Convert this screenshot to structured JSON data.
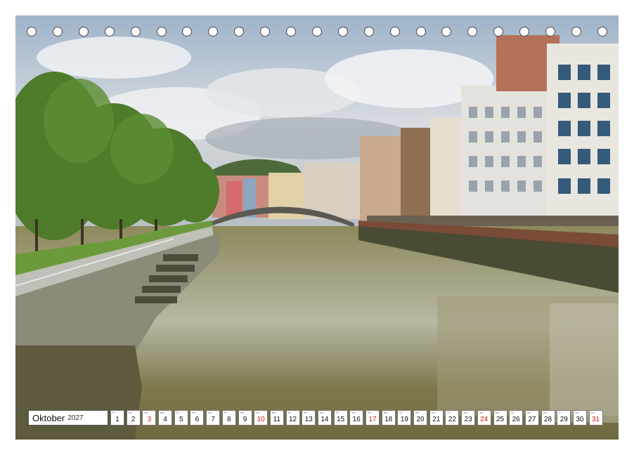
{
  "photo": {
    "subject": "river-city-scene-icon",
    "colors": {
      "sky": "#c9d2dc",
      "water": "#8b8457",
      "trees": "#4f7d2a",
      "buildings": "#d9d3c4"
    }
  },
  "calendar": {
    "month": "Oktober",
    "year": "2027",
    "sunday_color": "#d11a1a",
    "days": [
      {
        "d": "1",
        "wd": "Fr",
        "sun": false
      },
      {
        "d": "2",
        "wd": "Sa",
        "sun": false
      },
      {
        "d": "3",
        "wd": "So",
        "sun": true
      },
      {
        "d": "4",
        "wd": "Mo",
        "sun": false
      },
      {
        "d": "5",
        "wd": "Di",
        "sun": false
      },
      {
        "d": "6",
        "wd": "Mi",
        "sun": false
      },
      {
        "d": "7",
        "wd": "Do",
        "sun": false
      },
      {
        "d": "8",
        "wd": "Fr",
        "sun": false
      },
      {
        "d": "9",
        "wd": "Sa",
        "sun": false
      },
      {
        "d": "10",
        "wd": "So",
        "sun": true
      },
      {
        "d": "11",
        "wd": "Mo",
        "sun": false
      },
      {
        "d": "12",
        "wd": "Di",
        "sun": false
      },
      {
        "d": "13",
        "wd": "Mi",
        "sun": false
      },
      {
        "d": "14",
        "wd": "Do",
        "sun": false
      },
      {
        "d": "15",
        "wd": "Fr",
        "sun": false
      },
      {
        "d": "16",
        "wd": "Sa",
        "sun": false
      },
      {
        "d": "17",
        "wd": "So",
        "sun": true
      },
      {
        "d": "18",
        "wd": "Mo",
        "sun": false
      },
      {
        "d": "19",
        "wd": "Di",
        "sun": false
      },
      {
        "d": "20",
        "wd": "Mi",
        "sun": false
      },
      {
        "d": "21",
        "wd": "Do",
        "sun": false
      },
      {
        "d": "22",
        "wd": "Fr",
        "sun": false
      },
      {
        "d": "23",
        "wd": "Sa",
        "sun": false
      },
      {
        "d": "24",
        "wd": "So",
        "sun": true
      },
      {
        "d": "25",
        "wd": "Mo",
        "sun": false
      },
      {
        "d": "26",
        "wd": "Di",
        "sun": false
      },
      {
        "d": "27",
        "wd": "Mi",
        "sun": false
      },
      {
        "d": "28",
        "wd": "Do",
        "sun": false
      },
      {
        "d": "29",
        "wd": "Fr",
        "sun": false
      },
      {
        "d": "30",
        "wd": "Sa",
        "sun": false
      },
      {
        "d": "31",
        "wd": "So",
        "sun": true
      }
    ]
  },
  "binding": {
    "hole_count": 23
  }
}
